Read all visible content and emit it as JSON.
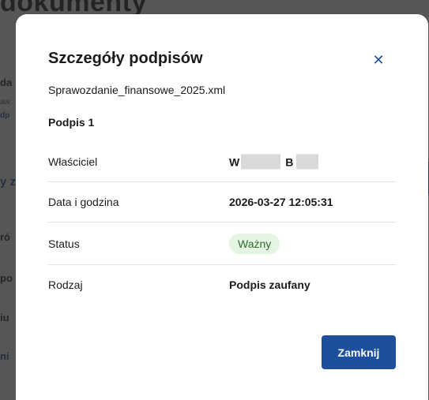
{
  "background": {
    "title_fragment": "dokumenty",
    "side_fragments": [
      "da",
      "aw",
      "dp",
      "y z",
      "ró",
      "po",
      "iu",
      "ni"
    ]
  },
  "modal": {
    "title": "Szczegóły podpisów",
    "close_icon": "close-icon",
    "file_name": "Sprawozdanie_finansowe_2025.xml",
    "signature_heading": "Podpis 1",
    "rows": {
      "owner": {
        "label": "Właściciel",
        "value_initial_1": "W",
        "value_initial_2": "B"
      },
      "datetime": {
        "label": "Data i godzina",
        "value": "2026-03-27 12:05:31"
      },
      "status": {
        "label": "Status",
        "value": "Ważny"
      },
      "type": {
        "label": "Rodzaj",
        "value": "Podpis zaufany"
      }
    },
    "close_button_label": "Zamknij"
  },
  "colors": {
    "accent": "#1d4f9c",
    "badge_bg": "#e5f5e3",
    "badge_text": "#2e6b2b",
    "overlay": "#262626"
  }
}
